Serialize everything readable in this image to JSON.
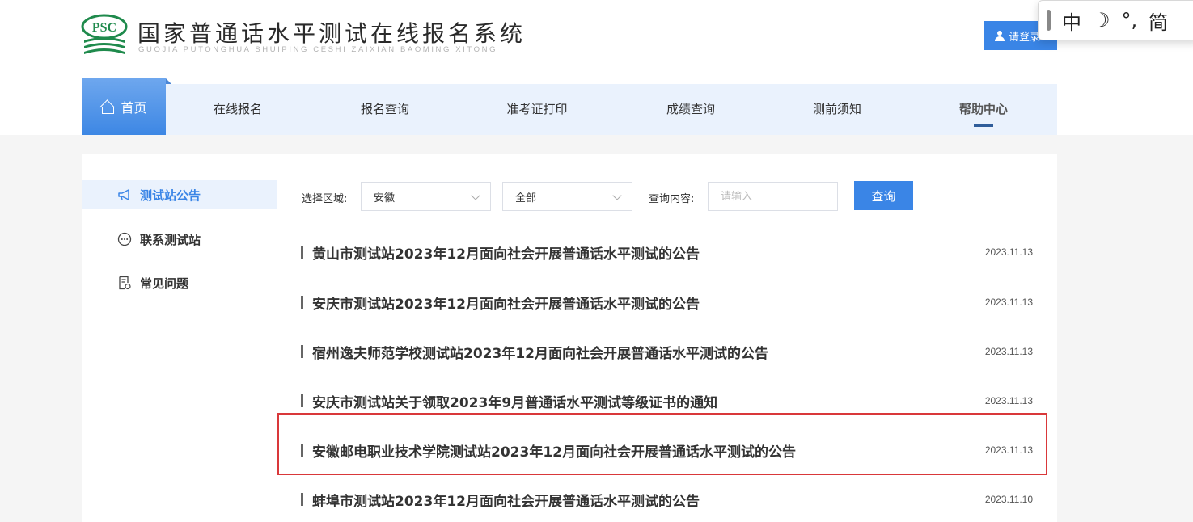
{
  "header": {
    "logo_text": "PSC",
    "title": "国家普通话水平测试在线报名系统",
    "subtitle": "GUOJIA PUTONGHUA SHUIPING CESHI ZAIXIAN BAOMING XITONG",
    "login_label": "请登录"
  },
  "ime_toolbar": {
    "items": [
      "中",
      "☽",
      "°,",
      "简"
    ]
  },
  "nav": {
    "home": "首页",
    "items": [
      "在线报名",
      "报名查询",
      "准考证打印",
      "成绩查询",
      "测前须知",
      "帮助中心"
    ],
    "active": "帮助中心"
  },
  "sidebar": {
    "items": [
      {
        "label": "测试站公告",
        "icon": "megaphone-icon",
        "active": true
      },
      {
        "label": "联系测试站",
        "icon": "chat-icon",
        "active": false
      },
      {
        "label": "常见问题",
        "icon": "document-icon",
        "active": false
      }
    ]
  },
  "filters": {
    "region_label": "选择区域:",
    "province": "安徽",
    "scope": "全部",
    "query_label": "查询内容:",
    "query_placeholder": "请输入",
    "query_value": "",
    "query_button": "查询"
  },
  "notices": [
    {
      "title": "黄山市测试站2023年12月面向社会开展普通话水平测试的公告",
      "date": "2023.11.13"
    },
    {
      "title": "安庆市测试站2023年12月面向社会开展普通话水平测试的公告",
      "date": "2023.11.13"
    },
    {
      "title": "宿州逸夫师范学校测试站2023年12月面向社会开展普通话水平测试的公告",
      "date": "2023.11.13"
    },
    {
      "title": "安庆市测试站关于领取2023年9月普通话水平测试等级证书的通知",
      "date": "2023.11.13"
    },
    {
      "title": "安徽邮电职业技术学院测试站2023年12月面向社会开展普通话水平测试的公告",
      "date": "2023.11.13"
    },
    {
      "title": "蚌埠市测试站2023年12月面向社会开展普通话水平测试的公告",
      "date": "2023.11.10"
    }
  ],
  "colors": {
    "accent": "#3a85e6",
    "nav_bg": "#eaf2fd",
    "logo_green": "#1f8a4c",
    "highlight": "#d9383a"
  }
}
